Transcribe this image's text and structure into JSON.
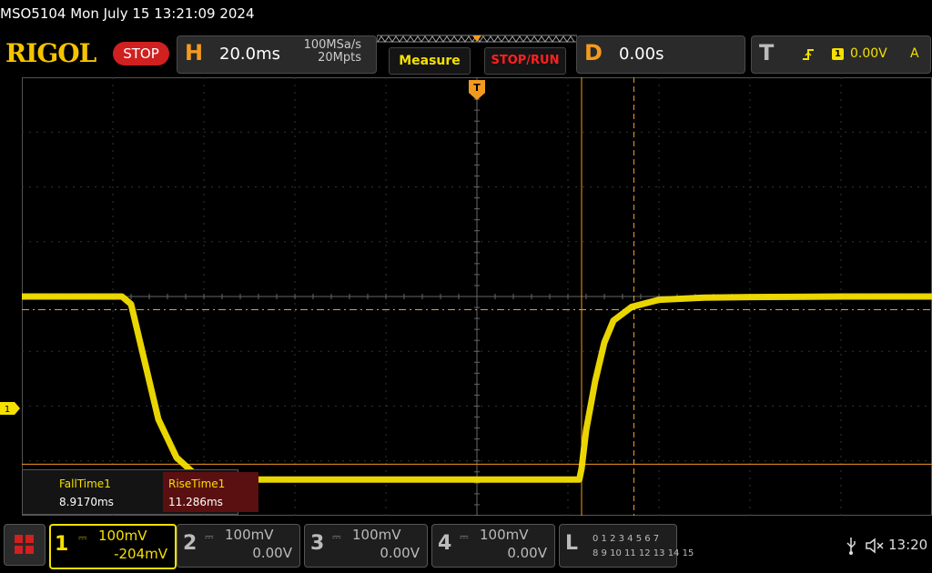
{
  "title_bar": {
    "text": "MSO5104  Mon July 15 13:21:09 2024"
  },
  "top": {
    "logo": "RIGOL",
    "run_state": "STOP",
    "horizontal": {
      "letter": "H",
      "timebase": "20.0ms",
      "sample_rate": "100MSa/s",
      "memory_depth": "20Mpts"
    },
    "measure_label": "Measure",
    "stop_run_label": "STOP/RUN",
    "delay": {
      "letter": "D",
      "value": "0.00s"
    },
    "trigger": {
      "letter": "T",
      "edge_icon": "rising-edge-icon",
      "source": "1",
      "level": "0.00V",
      "mode": "A"
    }
  },
  "ch1_marker": "1",
  "trigger_marker": "T",
  "measurements": [
    {
      "name": "FallTime1",
      "value": "8.9170ms"
    },
    {
      "name": "RiseTime1",
      "value": "11.286ms"
    }
  ],
  "channels": [
    {
      "num": "1",
      "coupling_icon": "dc-coupling-icon",
      "scale": "100mV",
      "offset": "-204mV",
      "active": true
    },
    {
      "num": "2",
      "coupling_icon": "dc-coupling-icon",
      "scale": "100mV",
      "offset": "0.00V",
      "active": false
    },
    {
      "num": "3",
      "coupling_icon": "dc-coupling-icon",
      "scale": "100mV",
      "offset": "0.00V",
      "active": false
    },
    {
      "num": "4",
      "coupling_icon": "dc-coupling-icon",
      "scale": "100mV",
      "offset": "0.00V",
      "active": false
    }
  ],
  "logic": {
    "letter": "L",
    "row1": "0 1 2 3   4 5 6 7",
    "row2": "8 9 10 11  12 13 14 15"
  },
  "status": {
    "time": "13:20"
  },
  "colors": {
    "ch1": "#f5e000",
    "accent": "#f39a1e",
    "stop": "#d02020",
    "grid": "#3a3a3a",
    "cursor": "#f39a1e"
  },
  "chart_data": {
    "type": "line",
    "title": "",
    "xlabel": "",
    "ylabel": "",
    "x_unit": "ms",
    "y_unit": "mV",
    "x_per_div": 20.0,
    "y_per_div": 100,
    "series": [
      {
        "x": [
          -100,
          -78,
          -76,
          -74,
          -72,
          -70,
          -66,
          -62,
          -58,
          -50,
          -40,
          -20,
          0,
          20,
          22.5,
          23,
          24,
          26,
          28,
          30,
          34,
          40,
          50,
          60,
          80,
          100
        ],
        "y": [
          204,
          204,
          190,
          120,
          50,
          -20,
          -90,
          -120,
          -125,
          -130,
          -130,
          -130,
          -130,
          -130,
          -130,
          -110,
          -40,
          50,
          120,
          160,
          185,
          198,
          202,
          203,
          204,
          204
        ]
      }
    ]
  }
}
